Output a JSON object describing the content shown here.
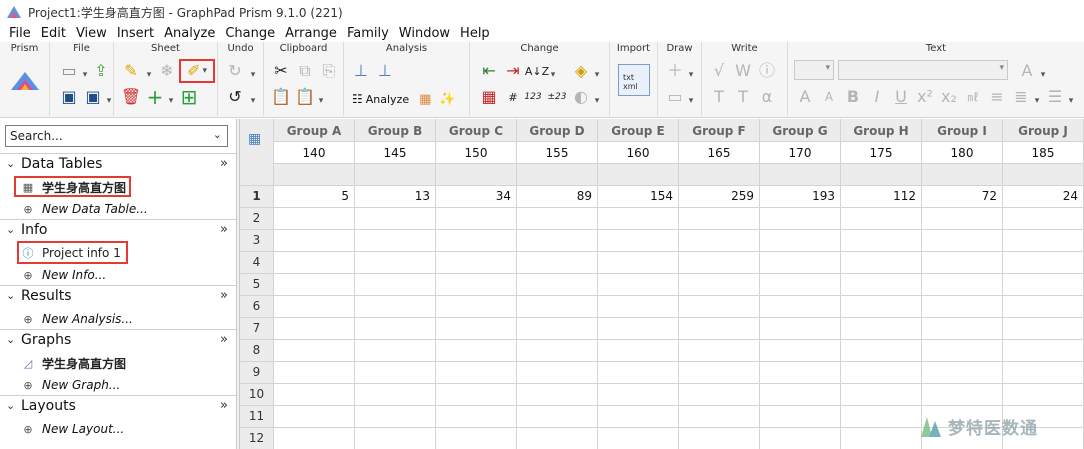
{
  "window": {
    "title": "Project1:学生身高直方图 - GraphPad Prism 9.1.0 (221)"
  },
  "menu": [
    "File",
    "Edit",
    "View",
    "Insert",
    "Analyze",
    "Change",
    "Arrange",
    "Family",
    "Window",
    "Help"
  ],
  "ribbon": {
    "groups": [
      "Prism",
      "File",
      "Sheet",
      "Undo",
      "Clipboard",
      "Analysis",
      "Change",
      "Import",
      "Draw",
      "Write",
      "Text"
    ],
    "analyze_label": "Analyze",
    "import_icon_text": "txt\nxml",
    "change_icons": {
      "sort_text": "A↓Z",
      "num123": "123",
      "strike123": "±23"
    }
  },
  "navigator": {
    "search_placeholder": "Search...",
    "sections": [
      {
        "title": "Data Tables",
        "items": [
          {
            "label": "学生身高直方图",
            "bold": true,
            "icon": "table-icon"
          }
        ],
        "new_label": "New Data Table..."
      },
      {
        "title": "Info",
        "items": [
          {
            "label": "Project info 1",
            "bold": false,
            "icon": "info-icon"
          }
        ],
        "new_label": "New Info..."
      },
      {
        "title": "Results",
        "items": [],
        "new_label": "New Analysis..."
      },
      {
        "title": "Graphs",
        "items": [
          {
            "label": "学生身高直方图",
            "bold": true,
            "icon": "graph-icon"
          }
        ],
        "new_label": "New Graph..."
      },
      {
        "title": "Layouts",
        "items": [],
        "new_label": "New Layout..."
      }
    ]
  },
  "table": {
    "columns": [
      {
        "title": "Group A",
        "sub": "140"
      },
      {
        "title": "Group B",
        "sub": "145"
      },
      {
        "title": "Group C",
        "sub": "150"
      },
      {
        "title": "Group D",
        "sub": "155"
      },
      {
        "title": "Group E",
        "sub": "160"
      },
      {
        "title": "Group F",
        "sub": "165"
      },
      {
        "title": "Group G",
        "sub": "170"
      },
      {
        "title": "Group H",
        "sub": "175"
      },
      {
        "title": "Group I",
        "sub": "180"
      },
      {
        "title": "Group J",
        "sub": "185"
      }
    ],
    "row_numbers": [
      "1",
      "2",
      "3",
      "4",
      "5",
      "6",
      "7",
      "8",
      "9",
      "10",
      "11",
      "12"
    ],
    "rows": [
      [
        "5",
        "13",
        "34",
        "89",
        "154",
        "259",
        "193",
        "112",
        "72",
        "24"
      ]
    ]
  },
  "watermark": "梦特医数通"
}
